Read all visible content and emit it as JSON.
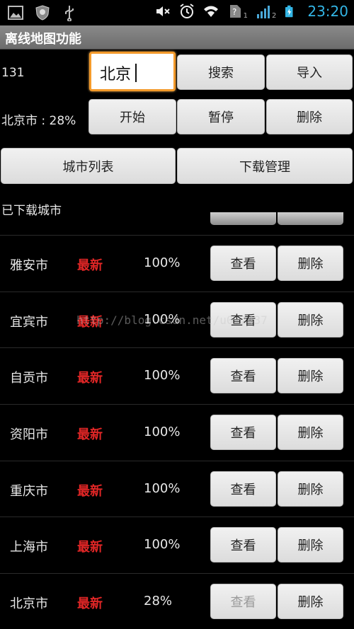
{
  "status_bar": {
    "time": "23:20",
    "sim1_label": "1",
    "sim2_label": "2",
    "icons": [
      "image-icon",
      "shield-icon",
      "usb-icon",
      "mute-icon",
      "alarm-icon",
      "wifi-icon",
      "no-sim-icon",
      "signal-icon",
      "battery-charging-icon"
    ],
    "time_color": "#33b5e5"
  },
  "app": {
    "title": "离线地图功能"
  },
  "controls": {
    "city_code": "131",
    "search_value": "北京",
    "search_button": "搜索",
    "import_button": "导入",
    "progress_text": "北京市 : 28%",
    "start_button": "开始",
    "pause_button": "暂停",
    "delete_button": "删除",
    "focus_color": "#f39a2b"
  },
  "tabs": {
    "city_list": "城市列表",
    "download_manager": "下载管理"
  },
  "downloaded": {
    "header": "已下载城市",
    "status_color": "#e02626",
    "rows": [
      {
        "city": "雅安市",
        "status": "最新",
        "progress": "100%",
        "view": "查看",
        "delete": "删除"
      },
      {
        "city": "宜宾市",
        "status": "最新",
        "progress": "100%",
        "view": "查看",
        "delete": "删除"
      },
      {
        "city": "自贡市",
        "status": "最新",
        "progress": "100%",
        "view": "查看",
        "delete": "删除"
      },
      {
        "city": "资阳市",
        "status": "最新",
        "progress": "100%",
        "view": "查看",
        "delete": "删除"
      },
      {
        "city": "重庆市",
        "status": "最新",
        "progress": "100%",
        "view": "查看",
        "delete": "删除"
      },
      {
        "city": "上海市",
        "status": "最新",
        "progress": "100%",
        "view": "查看",
        "delete": "删除"
      },
      {
        "city": "北京市",
        "status": "最新",
        "progress": "28%",
        "view": "查看",
        "delete": "删除"
      }
    ]
  },
  "watermark": "http://blog.csdn.net/u0       2437"
}
